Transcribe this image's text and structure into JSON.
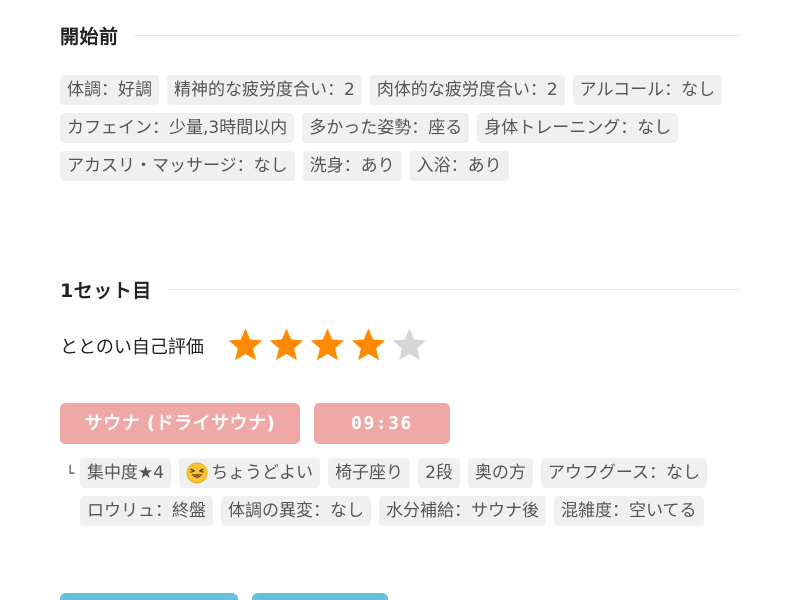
{
  "before": {
    "title": "開始前",
    "tags": [
      "体調：好調",
      "精神的な疲労度合い：2",
      "肉体的な疲労度合い：2",
      "アルコール：なし",
      "カフェイン：少量,3時間以内",
      "多かった姿勢：座る",
      "身体トレーニング：なし",
      "アカスリ・マッサージ：なし",
      "洗身：あり",
      "入浴：あり"
    ]
  },
  "set1": {
    "title": "1セット目",
    "rating_label": "ととのい自己評価",
    "rating": 4,
    "rating_max": 5,
    "star_color": "#ff8a00",
    "star_empty_color": "#d6d6d6",
    "sauna_type": "サウナ (ドライサウナ)",
    "duration": "09:36",
    "pill_color": "#f0a8a6",
    "branch_glyph": "└",
    "tags": [
      {
        "icon": "",
        "text": "集中度★4"
      },
      {
        "icon": "grinning-squinting-face-icon",
        "text": "ちょうどよい"
      },
      {
        "icon": "",
        "text": "椅子座り"
      },
      {
        "icon": "",
        "text": "2段"
      },
      {
        "icon": "",
        "text": "奥の方"
      },
      {
        "icon": "",
        "text": "アウフグース：なし"
      },
      {
        "icon": "",
        "text": "ロウリュ：終盤"
      },
      {
        "icon": "",
        "text": "体調の異変：なし"
      },
      {
        "icon": "",
        "text": "水分補給：サウナ後"
      },
      {
        "icon": "",
        "text": "混雑度：空いてる"
      }
    ]
  },
  "next_pill_color": "#66c0d8"
}
